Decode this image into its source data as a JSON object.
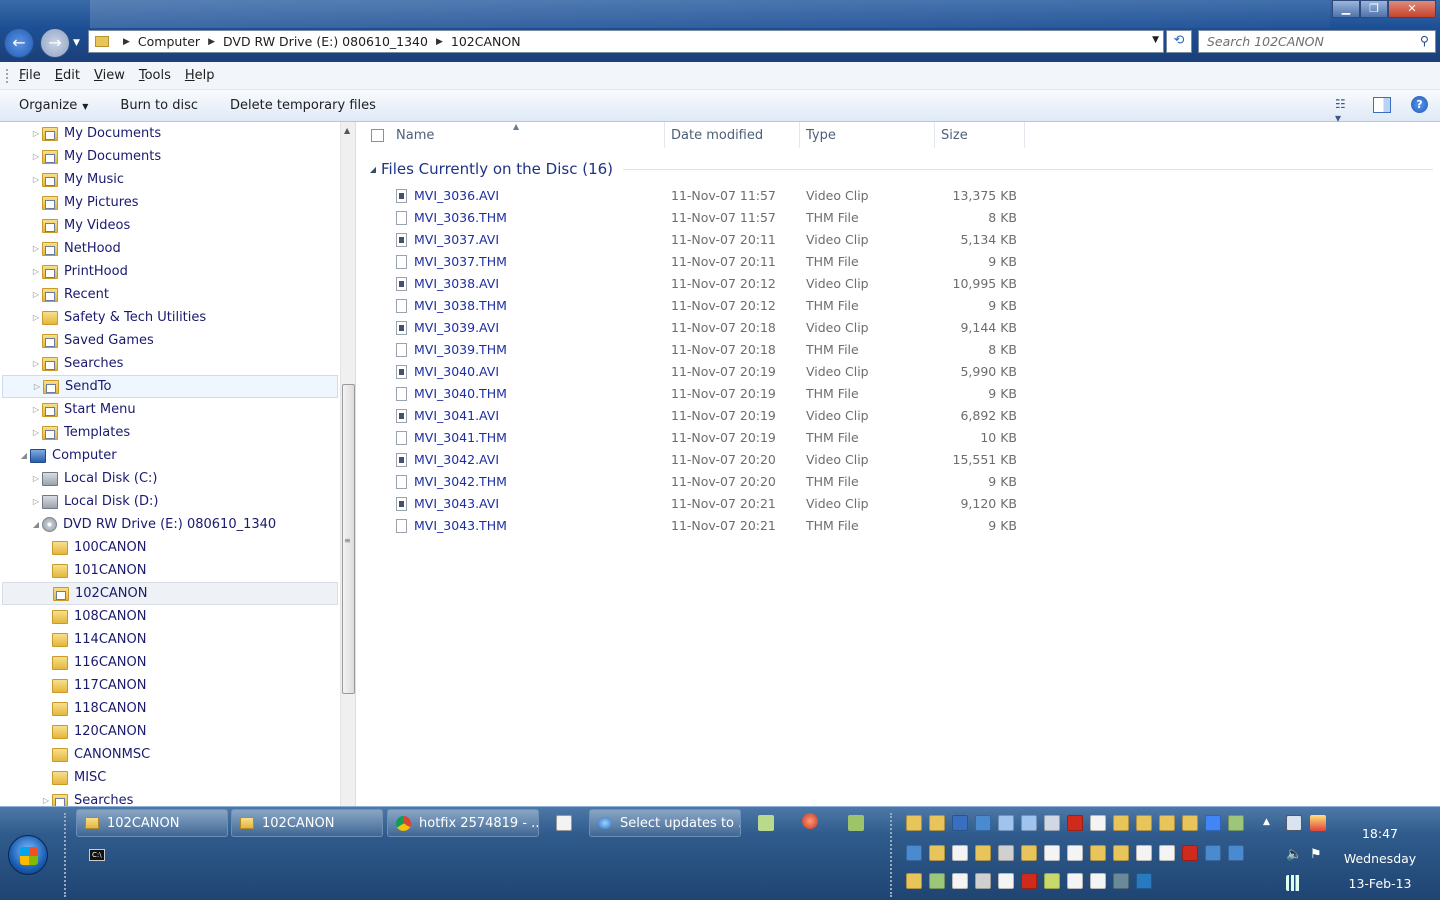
{
  "window": {
    "minimize": "▁",
    "maximize": "❐",
    "close": "✕"
  },
  "address": {
    "crumbs": [
      "Computer",
      "DVD RW Drive (E:) 080610_1340",
      "102CANON"
    ],
    "search_placeholder": "Search 102CANON"
  },
  "menu": [
    "File",
    "Edit",
    "View",
    "Tools",
    "Help"
  ],
  "commands": {
    "organize": "Organize",
    "burn": "Burn to disc",
    "delete_temp": "Delete temporary files"
  },
  "nav_tree": [
    {
      "label": "My Documents",
      "y": 0
    },
    {
      "label": "My Documents",
      "y": 1
    },
    {
      "label": "My Music",
      "y": 2
    },
    {
      "label": "My Pictures",
      "y": 3
    },
    {
      "label": "My Videos",
      "y": 4
    },
    {
      "label": "NetHood",
      "y": 5
    },
    {
      "label": "PrintHood",
      "y": 6
    },
    {
      "label": "Recent",
      "y": 7
    },
    {
      "label": "Safety & Tech Utilities",
      "y": 8
    },
    {
      "label": "Saved Games",
      "y": 9
    },
    {
      "label": "Searches",
      "y": 10
    },
    {
      "label": "SendTo",
      "y": 11
    },
    {
      "label": "Start Menu",
      "y": 12
    },
    {
      "label": "Templates",
      "y": 13
    },
    {
      "label": "Computer",
      "y": 14
    },
    {
      "label": "Local Disk (C:)",
      "y": 15
    },
    {
      "label": "Local Disk (D:)",
      "y": 16
    },
    {
      "label": "DVD RW Drive (E:) 080610_1340",
      "y": 17
    },
    {
      "label": "100CANON",
      "y": 18
    },
    {
      "label": "101CANON",
      "y": 19
    },
    {
      "label": "102CANON",
      "y": 20
    },
    {
      "label": "108CANON",
      "y": 21
    },
    {
      "label": "114CANON",
      "y": 22
    },
    {
      "label": "116CANON",
      "y": 23
    },
    {
      "label": "117CANON",
      "y": 24
    },
    {
      "label": "118CANON",
      "y": 25
    },
    {
      "label": "120CANON",
      "y": 26
    },
    {
      "label": "CANONMSC",
      "y": 27
    },
    {
      "label": "MISC",
      "y": 28
    },
    {
      "label": "Searches",
      "y": 29
    }
  ],
  "columns": {
    "name": "Name",
    "date": "Date modified",
    "type": "Type",
    "size": "Size"
  },
  "group_title": "Files Currently on the Disc (16)",
  "files": [
    {
      "name": "MVI_3036.AVI",
      "date": "11-Nov-07 11:57",
      "type": "Video Clip",
      "size": "13,375 KB"
    },
    {
      "name": "MVI_3036.THM",
      "date": "11-Nov-07 11:57",
      "type": "THM File",
      "size": "8 KB"
    },
    {
      "name": "MVI_3037.AVI",
      "date": "11-Nov-07 20:11",
      "type": "Video Clip",
      "size": "5,134 KB"
    },
    {
      "name": "MVI_3037.THM",
      "date": "11-Nov-07 20:11",
      "type": "THM File",
      "size": "9 KB"
    },
    {
      "name": "MVI_3038.AVI",
      "date": "11-Nov-07 20:12",
      "type": "Video Clip",
      "size": "10,995 KB"
    },
    {
      "name": "MVI_3038.THM",
      "date": "11-Nov-07 20:12",
      "type": "THM File",
      "size": "9 KB"
    },
    {
      "name": "MVI_3039.AVI",
      "date": "11-Nov-07 20:18",
      "type": "Video Clip",
      "size": "9,144 KB"
    },
    {
      "name": "MVI_3039.THM",
      "date": "11-Nov-07 20:18",
      "type": "THM File",
      "size": "8 KB"
    },
    {
      "name": "MVI_3040.AVI",
      "date": "11-Nov-07 20:19",
      "type": "Video Clip",
      "size": "5,990 KB"
    },
    {
      "name": "MVI_3040.THM",
      "date": "11-Nov-07 20:19",
      "type": "THM File",
      "size": "9 KB"
    },
    {
      "name": "MVI_3041.AVI",
      "date": "11-Nov-07 20:19",
      "type": "Video Clip",
      "size": "6,892 KB"
    },
    {
      "name": "MVI_3041.THM",
      "date": "11-Nov-07 20:19",
      "type": "THM File",
      "size": "10 KB"
    },
    {
      "name": "MVI_3042.AVI",
      "date": "11-Nov-07 20:20",
      "type": "Video Clip",
      "size": "15,551 KB"
    },
    {
      "name": "MVI_3042.THM",
      "date": "11-Nov-07 20:20",
      "type": "THM File",
      "size": "9 KB"
    },
    {
      "name": "MVI_3043.AVI",
      "date": "11-Nov-07 20:21",
      "type": "Video Clip",
      "size": "9,120 KB"
    },
    {
      "name": "MVI_3043.THM",
      "date": "11-Nov-07 20:21",
      "type": "THM File",
      "size": "9 KB"
    }
  ],
  "taskbar": {
    "tasks": [
      "102CANON",
      "102CANON",
      "hotfix 2574819 - ...",
      "Select updates to ..."
    ],
    "clock_time": "18:47",
    "clock_day": "Wednesday",
    "clock_date": "13-Feb-13"
  },
  "colors": {
    "link_blue": "#1e2ea0",
    "group_blue": "#1e3287",
    "taskbar": "#2f5b8c"
  }
}
